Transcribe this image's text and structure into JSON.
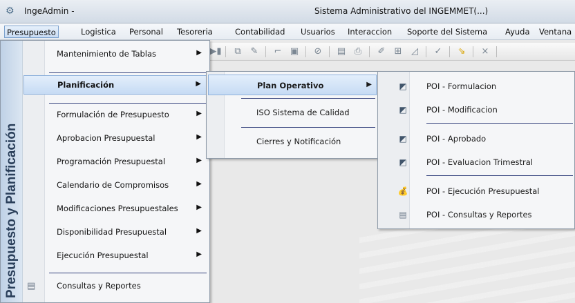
{
  "window": {
    "app_name": "IngeAdmin -",
    "system_title": "Sistema Administrativo del INGEMMET(...)"
  },
  "menubar": [
    {
      "label": "Presupuesto",
      "active": true
    },
    {
      "label": "Logistica"
    },
    {
      "label": "Personal"
    },
    {
      "label": "Tesoreria"
    },
    {
      "label": "Contabilidad"
    },
    {
      "label": "Usuarios"
    },
    {
      "label": "Interaccion"
    },
    {
      "label": "Soporte del Sistema"
    },
    {
      "label": "Ayuda"
    },
    {
      "label": "Ventana"
    }
  ],
  "side_band_title": "Presupuesto y Planificación",
  "presupuesto_menu": [
    {
      "label": "Mantenimiento de Tablas",
      "submenu": true
    },
    {
      "label": "Planificación",
      "submenu": true,
      "highlighted": true
    },
    {
      "label": "Formulación de Presupuesto",
      "submenu": true
    },
    {
      "label": "Aprobacion Presupuestal",
      "submenu": true
    },
    {
      "label": "Programación Presupuestal",
      "submenu": true
    },
    {
      "label": "Calendario de Compromisos",
      "submenu": true
    },
    {
      "label": "Modificaciones Presupuestales",
      "submenu": true
    },
    {
      "label": "Disponibilidad Presupuestal",
      "submenu": true
    },
    {
      "label": "Ejecución Presupuestal",
      "submenu": true
    },
    {
      "label": "Consultas y Reportes",
      "icon": "report-icon"
    }
  ],
  "planificacion_menu": [
    {
      "label": "Plan Operativo",
      "submenu": true,
      "highlighted": true
    },
    {
      "label": "ISO Sistema de Calidad"
    },
    {
      "label": "Cierres y Notificación"
    }
  ],
  "plan_operativo_menu": [
    {
      "label": "POI - Formulacion",
      "icon": "chart-edit-icon"
    },
    {
      "label": "POI - Modificacion",
      "icon": "chart-edit-icon"
    },
    {
      "label": "POI - Aprobado",
      "icon": "chart-edit-icon"
    },
    {
      "label": "POI - Evaluacion Trimestral",
      "icon": "chart-edit-icon"
    },
    {
      "label": "POI - Ejecución Presupuestal",
      "icon": "money-bag-icon"
    },
    {
      "label": "POI - Consultas y Reportes",
      "icon": "report-icon"
    }
  ],
  "glyphs": {
    "arrow": "▶",
    "gear": "⚙",
    "chart": "◩",
    "money": "💰",
    "report": "▤"
  }
}
